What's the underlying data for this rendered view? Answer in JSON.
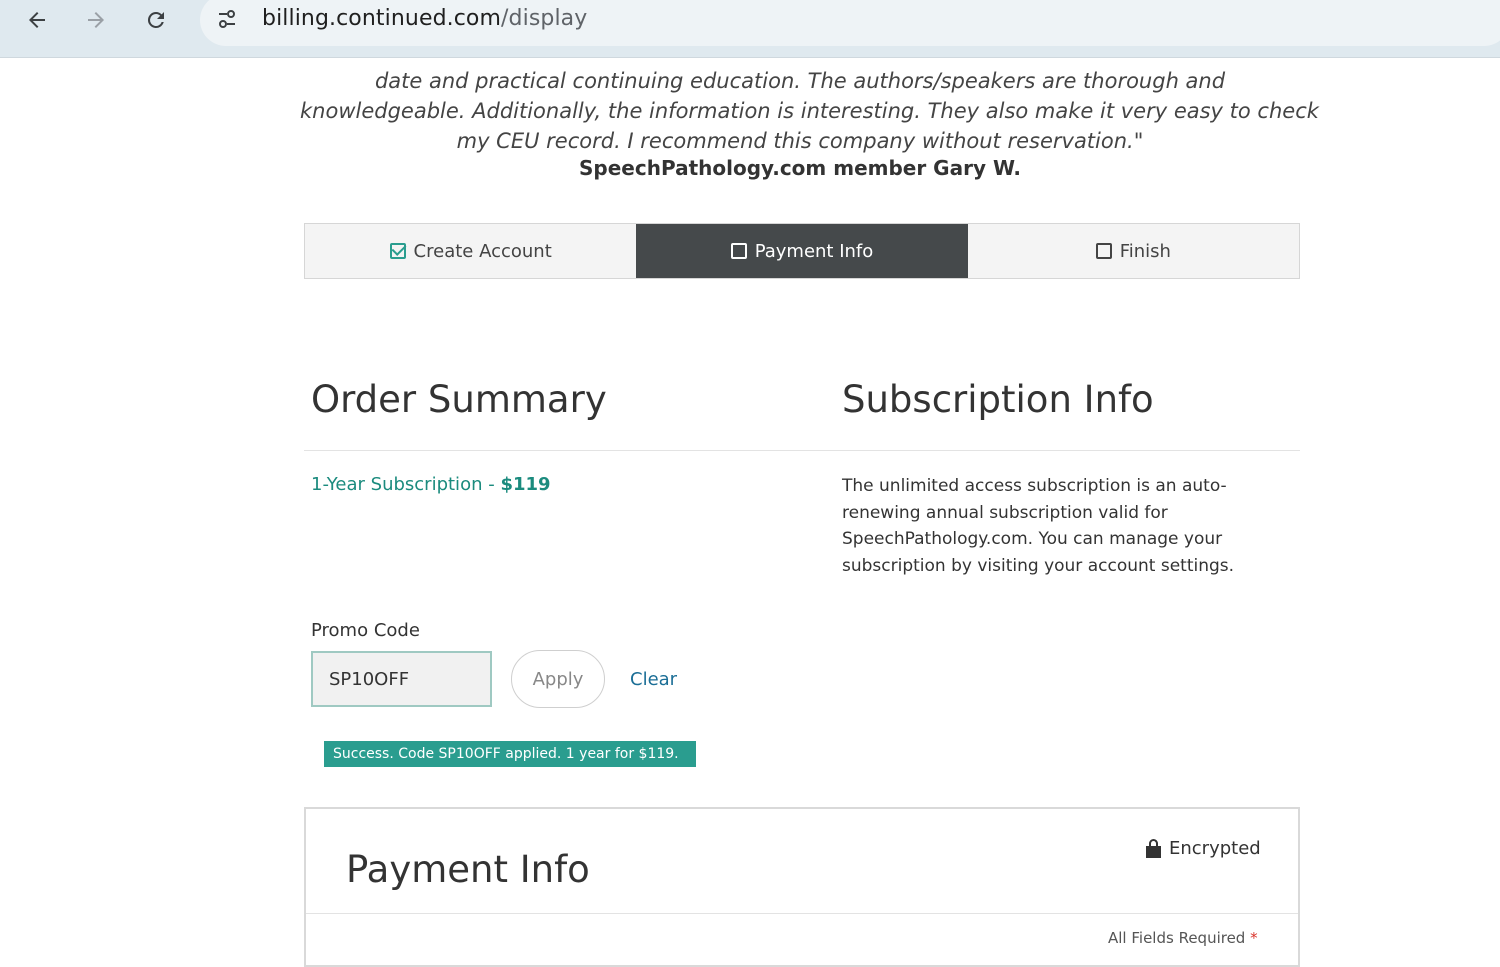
{
  "browser": {
    "url_host": "billing.continued.com",
    "url_path": "/display"
  },
  "testimonial": {
    "lines": [
      "date and practical continuing education. The authors/speakers are thorough and",
      "knowledgeable. Additionally, the information is interesting. They also make it very easy to check",
      "my CEU record. I recommend this company without reservation.\""
    ],
    "author": "SpeechPathology.com member Gary W."
  },
  "steps": [
    {
      "label": "Create Account",
      "state": "done"
    },
    {
      "label": "Payment Info",
      "state": "active"
    },
    {
      "label": "Finish",
      "state": "pending"
    }
  ],
  "order_summary": {
    "title": "Order Summary",
    "plan_name": "1-Year Subscription",
    "plan_separator": " - ",
    "plan_price": "$119"
  },
  "subscription_info": {
    "title": "Subscription Info",
    "description": "The unlimited access subscription is an auto-renewing annual subscription valid for SpeechPathology.com. You can manage your subscription by visiting your account settings."
  },
  "promo": {
    "label": "Promo Code",
    "value": "SP10OFF",
    "apply_label": "Apply",
    "clear_label": "Clear",
    "success_message": "Success. Code SP10OFF applied. 1 year for $119."
  },
  "payment": {
    "title": "Payment Info",
    "encrypted_label": "Encrypted",
    "fields_required": "All Fields Required",
    "required_marker": "*"
  },
  "colors": {
    "accent": "#2a9d8f",
    "link": "#1b6e96",
    "active_step": "#45494b"
  }
}
